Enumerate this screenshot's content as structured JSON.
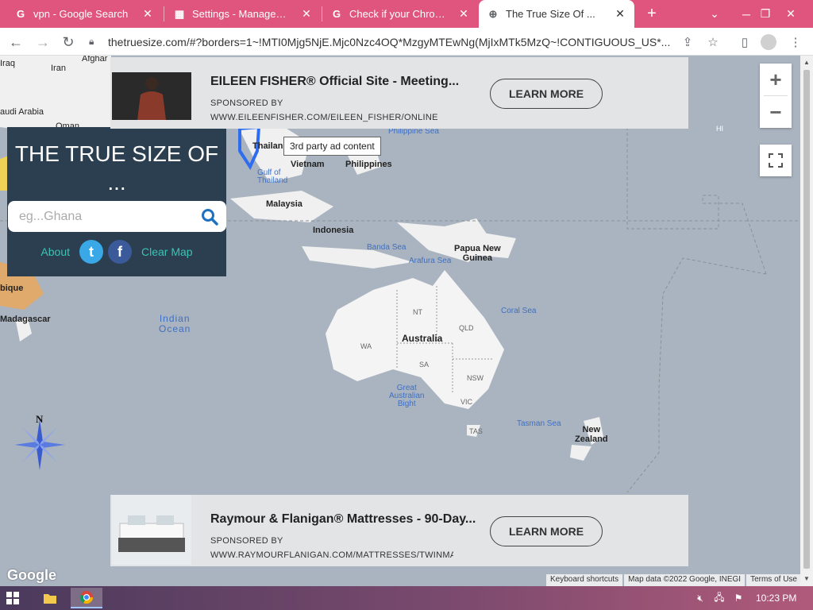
{
  "browser": {
    "tabs": [
      {
        "title": "vpn - Google Search",
        "icon": "google-icon",
        "active": false
      },
      {
        "title": "Settings - Management",
        "icon": "settings-icon",
        "active": false
      },
      {
        "title": "Check if your Chrome br",
        "icon": "google-icon",
        "active": false
      },
      {
        "title": "The True Size Of ...",
        "icon": "globe-icon",
        "active": true
      }
    ],
    "new_tab_label": "+",
    "url": "thetruesize.com/#?borders=1~!MTI0Mjg5NjE.Mjc0Nzc4OQ*MzgyMTEwNg(MjIxMTk5MzQ~!CONTIGUOUS_US*..."
  },
  "app": {
    "title": "THE TRUE SIZE OF ...",
    "search_placeholder": "eg...Ghana",
    "about_label": "About",
    "clear_map_label": "Clear Map",
    "twitter_glyph": "t",
    "facebook_glyph": "f"
  },
  "ads": [
    {
      "title": "EILEEN FISHER® Official Site - Meeting...",
      "sponsor_label": "SPONSORED BY",
      "url": "WWW.EILEENFISHER.COM/EILEEN_FISHER/ONLINE",
      "button_label": "LEARN MORE"
    },
    {
      "title": "Raymour & Flanigan® Mattresses - 90-Day...",
      "sponsor_label": "SPONSORED BY",
      "url": "WWW.RAYMOURFLANIGAN.COM/MATTRESSES/TWINMA",
      "button_label": "LEARN MORE"
    }
  ],
  "tooltip": "3rd party ad content",
  "map": {
    "labels": {
      "iraq": "Iraq",
      "iran": "Iran",
      "afghan": "Afghar",
      "saudi": "audi Arabia",
      "oman": "Oman",
      "thailand": "Thailan",
      "vietnam": "Vietnam",
      "philippines": "Philippines",
      "philippine_sea": "Philippine Sea",
      "gulf_thailand": "Gulf of\nThailand",
      "malaysia": "Malaysia",
      "indonesia": "Indonesia",
      "banda_sea": "Banda Sea",
      "arafura_sea": "Arafura Sea",
      "png": "Papua New\nGuinea",
      "coral_sea": "Coral Sea",
      "indian_ocean": "Indian\nOcean",
      "australia": "Australia",
      "wa": "WA",
      "nt": "NT",
      "qld": "QLD",
      "sa": "SA",
      "nsw": "NSW",
      "vic": "VIC",
      "tas": "TAS",
      "great_bight": "Great\nAustralian\nBight",
      "tasman_sea": "Tasman Sea",
      "nz": "New\nZealand",
      "madagascar": "Madagascar",
      "mozambique": "bique",
      "hi": "HI",
      "compass_n": "N"
    },
    "footer": {
      "keyboard": "Keyboard shortcuts",
      "data": "Map data ©2022 Google, INEGI",
      "terms": "Terms of Use"
    },
    "google_logo": "Google"
  },
  "taskbar": {
    "time": "10:23 PM"
  }
}
